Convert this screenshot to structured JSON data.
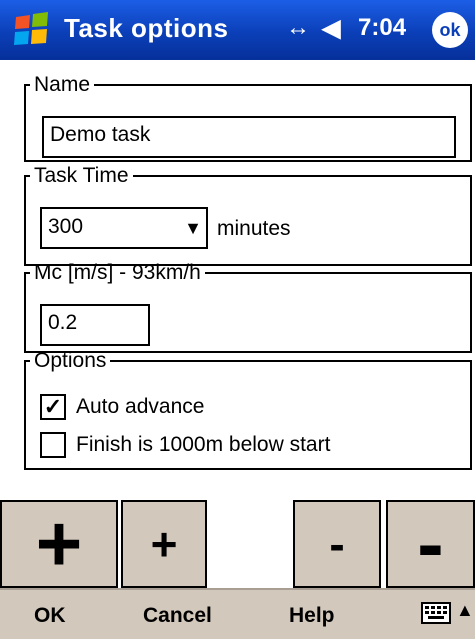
{
  "titlebar": {
    "title": "Task options",
    "time": "7:04",
    "ok_label": "ok",
    "net_icon": "↔",
    "vol_icon": "◀"
  },
  "name_group": {
    "legend": "Name",
    "value": "Demo task"
  },
  "time_group": {
    "legend": "Task Time",
    "value": "300",
    "unit": "minutes"
  },
  "mc_group": {
    "legend": "Mc [m/s] - 93km/h",
    "value": "0.2"
  },
  "options_group": {
    "legend": "Options",
    "auto_advance": {
      "label": "Auto advance",
      "checked": true,
      "mark": "✓"
    },
    "finish_below": {
      "label": "Finish is 1000m below start",
      "checked": false,
      "mark": ""
    }
  },
  "buttons": {
    "plus_large": "+",
    "plus_small": "+",
    "minus_small": "-",
    "minus_large": "-"
  },
  "menubar": {
    "ok": "OK",
    "cancel": "Cancel",
    "help": "Help",
    "sip_arrow": "▲"
  }
}
